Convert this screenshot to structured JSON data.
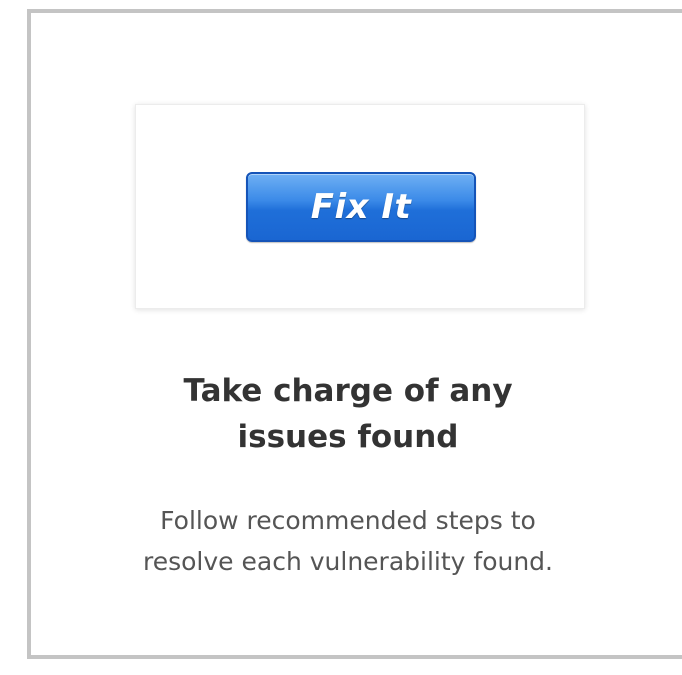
{
  "card": {
    "button_label": "Fix It",
    "heading_line1": "Take charge of any",
    "heading_line2": "issues found",
    "description_line1": "Follow recommended steps to",
    "description_line2": "resolve each vulnerability found."
  },
  "colors": {
    "button_blue": "#1f6fd9",
    "heading_text": "#333333",
    "body_text": "#555555",
    "card_border": "#c4c4c4"
  }
}
